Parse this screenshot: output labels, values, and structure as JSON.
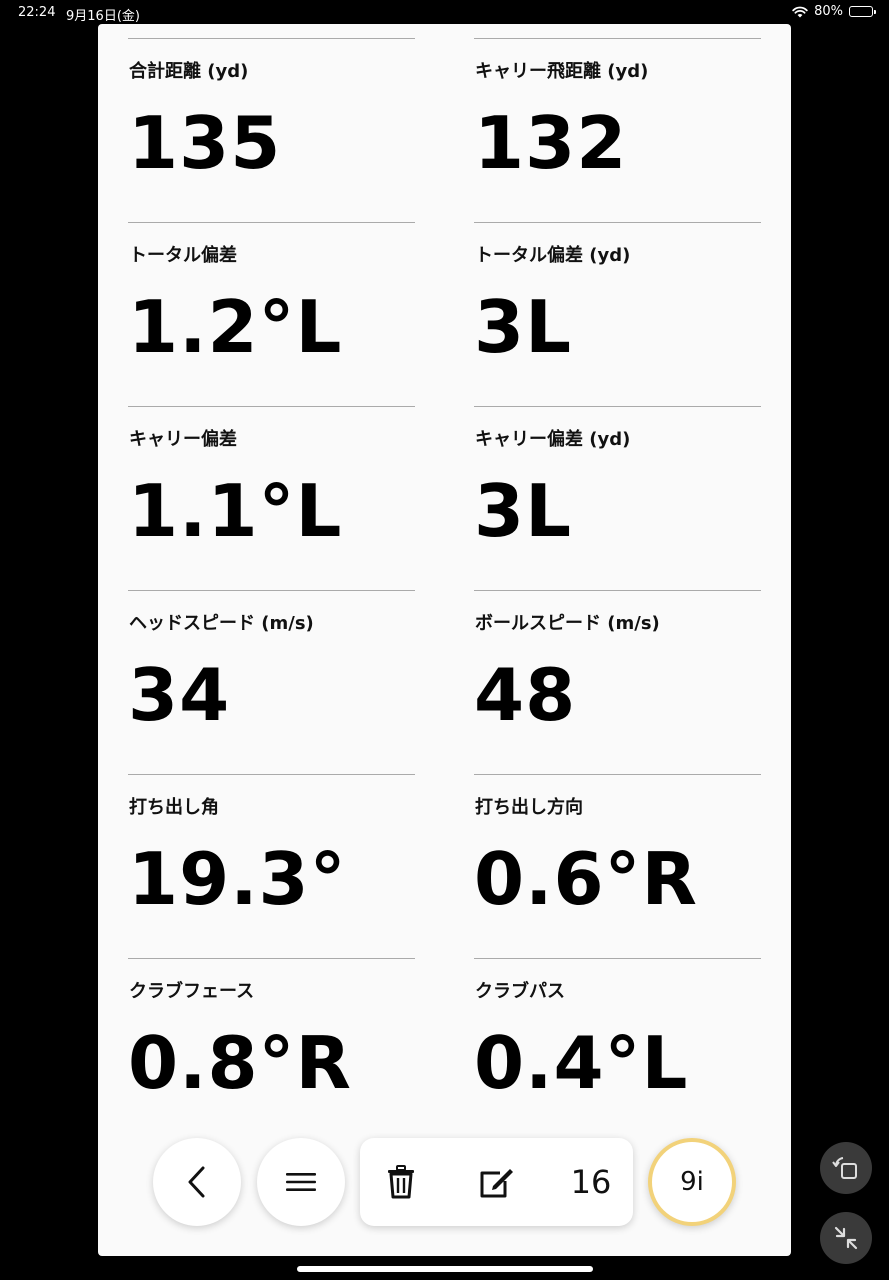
{
  "status_bar": {
    "time": "22:24",
    "date": "9月16日(金)",
    "battery": "80%",
    "battery_level": 0.8
  },
  "metrics": [
    {
      "label": "合計距離 (yd)",
      "value": "135"
    },
    {
      "label": "キャリー飛距離 (yd)",
      "value": "132"
    },
    {
      "label": "トータル偏差",
      "value": "1.2°L"
    },
    {
      "label": "トータル偏差 (yd)",
      "value": "3L"
    },
    {
      "label": "キャリー偏差",
      "value": "1.1°L"
    },
    {
      "label": "キャリー偏差 (yd)",
      "value": "3L"
    },
    {
      "label": "ヘッドスピード (m/s)",
      "value": "34"
    },
    {
      "label": "ボールスピード (m/s)",
      "value": "48"
    },
    {
      "label": "打ち出し角",
      "value": "19.3°"
    },
    {
      "label": "打ち出し方向",
      "value": "0.6°R"
    },
    {
      "label": "クラブフェース",
      "value": "0.8°R"
    },
    {
      "label": "クラブパス",
      "value": "0.4°L"
    }
  ],
  "toolbar": {
    "back_icon": "chevron-left-icon",
    "menu_icon": "hamburger-menu-icon",
    "delete_icon": "trash-icon",
    "edit_icon": "edit-icon",
    "shot_count": "16",
    "club": "9i",
    "club_ring_color": "#f2d27a"
  },
  "side_buttons": {
    "rotate_icon": "rotate-icon",
    "collapse_icon": "collapse-icon"
  }
}
